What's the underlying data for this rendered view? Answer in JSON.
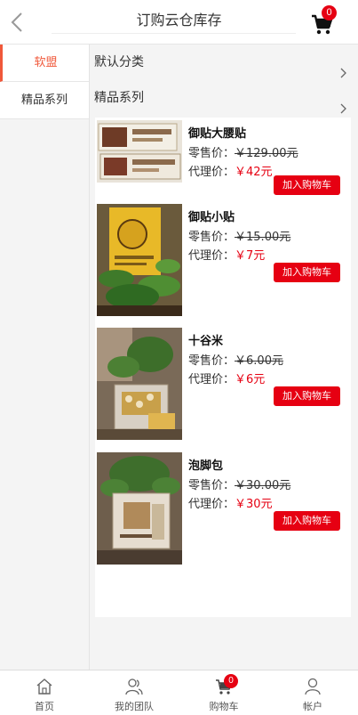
{
  "header": {
    "title": "订购云仓库存",
    "cart_count": "0"
  },
  "sidebar": {
    "items": [
      {
        "label": "软盟"
      },
      {
        "label": "精品系列"
      }
    ]
  },
  "categories": [
    {
      "label": "默认分类"
    },
    {
      "label": "精品系列"
    }
  ],
  "products": [
    {
      "name": "御贴大腰贴",
      "retail_label": "零售价：",
      "retail_price": "￥129.00元",
      "agent_label": "代理价：",
      "agent_price": "￥42元",
      "button": "加入购物车"
    },
    {
      "name": "御贴小贴",
      "retail_label": "零售价：",
      "retail_price": "￥15.00元",
      "agent_label": "代理价：",
      "agent_price": "￥7元",
      "button": "加入购物车"
    },
    {
      "name": "十谷米",
      "retail_label": "零售价：",
      "retail_price": "￥6.00元",
      "agent_label": "代理价：",
      "agent_price": "￥6元",
      "button": "加入购物车"
    },
    {
      "name": "泡脚包",
      "retail_label": "零售价：",
      "retail_price": "￥30.00元",
      "agent_label": "代理价：",
      "agent_price": "￥30元",
      "button": "加入购物车"
    }
  ],
  "bottom_nav": {
    "items": [
      {
        "label": "首页",
        "icon": "home-icon"
      },
      {
        "label": "我的团队",
        "icon": "team-icon"
      },
      {
        "label": "购物车",
        "icon": "cart-icon"
      },
      {
        "label": "帐户",
        "icon": "account-icon"
      }
    ],
    "cart_count": "0"
  },
  "colors": {
    "accent": "#e60012",
    "sidebar_active": "#f0583a"
  }
}
